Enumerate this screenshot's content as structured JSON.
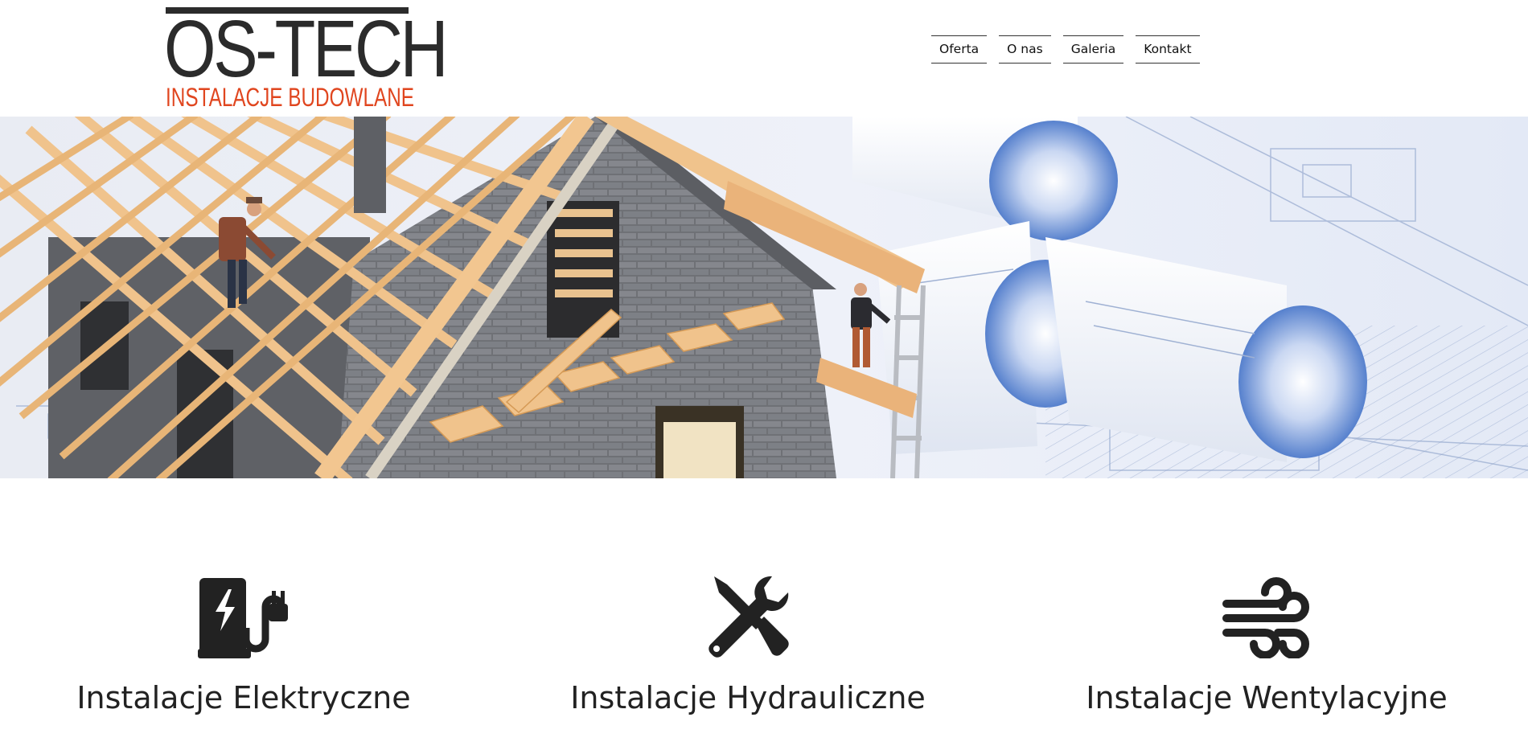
{
  "logo": {
    "main": "OS-TECH",
    "sub": "INSTALACJE BUDOWLANE"
  },
  "nav": {
    "items": [
      {
        "label": "Oferta"
      },
      {
        "label": "O nas"
      },
      {
        "label": "Galeria"
      },
      {
        "label": "Kontakt"
      }
    ]
  },
  "hero": {
    "image": "house-construction-model-with-blueprints"
  },
  "services": [
    {
      "title": "Instalacje Elektryczne",
      "icon": "ev-charger-icon"
    },
    {
      "title": "Instalacje Hydrauliczne",
      "icon": "wrench-screwdriver-icon"
    },
    {
      "title": "Instalacje Wentylacyjne",
      "icon": "wind-icon"
    }
  ],
  "colors": {
    "accent": "#e0461f",
    "text": "#222222",
    "logo_dark": "#2b2b2b",
    "background": "#ffffff"
  }
}
